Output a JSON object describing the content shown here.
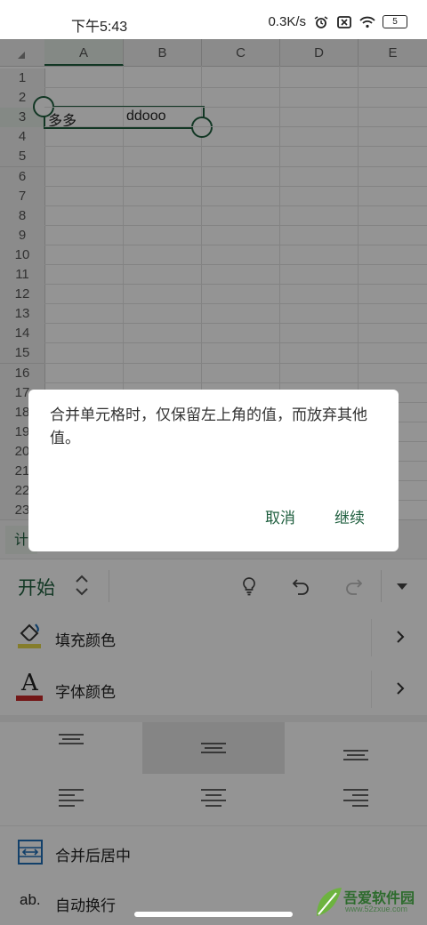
{
  "status": {
    "time": "下午5:43",
    "speed": "0.3K/s",
    "battery": "5"
  },
  "sheet": {
    "columns": [
      "A",
      "B",
      "C",
      "D",
      "E"
    ],
    "rows": [
      "1",
      "2",
      "3",
      "4",
      "5",
      "6",
      "7",
      "8",
      "9",
      "10",
      "11",
      "12",
      "13",
      "14",
      "15",
      "16",
      "17",
      "18",
      "19",
      "20",
      "21",
      "22",
      "23"
    ],
    "cells": {
      "A3": "多多",
      "B3": "ddooo"
    }
  },
  "tabbar": {
    "tab_label": "计"
  },
  "toolbar": {
    "start_label": "开始"
  },
  "menu": {
    "fill_color": "填充颜色",
    "font_color": "字体颜色",
    "merge_center": "合并后居中",
    "auto_wrap": "自动换行",
    "font_icon_letter": "A",
    "wrap_icon_text": "ab."
  },
  "dialog": {
    "message": "合并单元格时，仅保留左上角的值，而放弃其他值。",
    "cancel": "取消",
    "continue": "继续"
  },
  "watermark": {
    "text": "吾爱软件园",
    "url": "www.52zxue.com"
  },
  "colors": {
    "accent": "#1f5f3f",
    "fill_bar": "#e6d84a",
    "font_bar": "#c62828"
  }
}
